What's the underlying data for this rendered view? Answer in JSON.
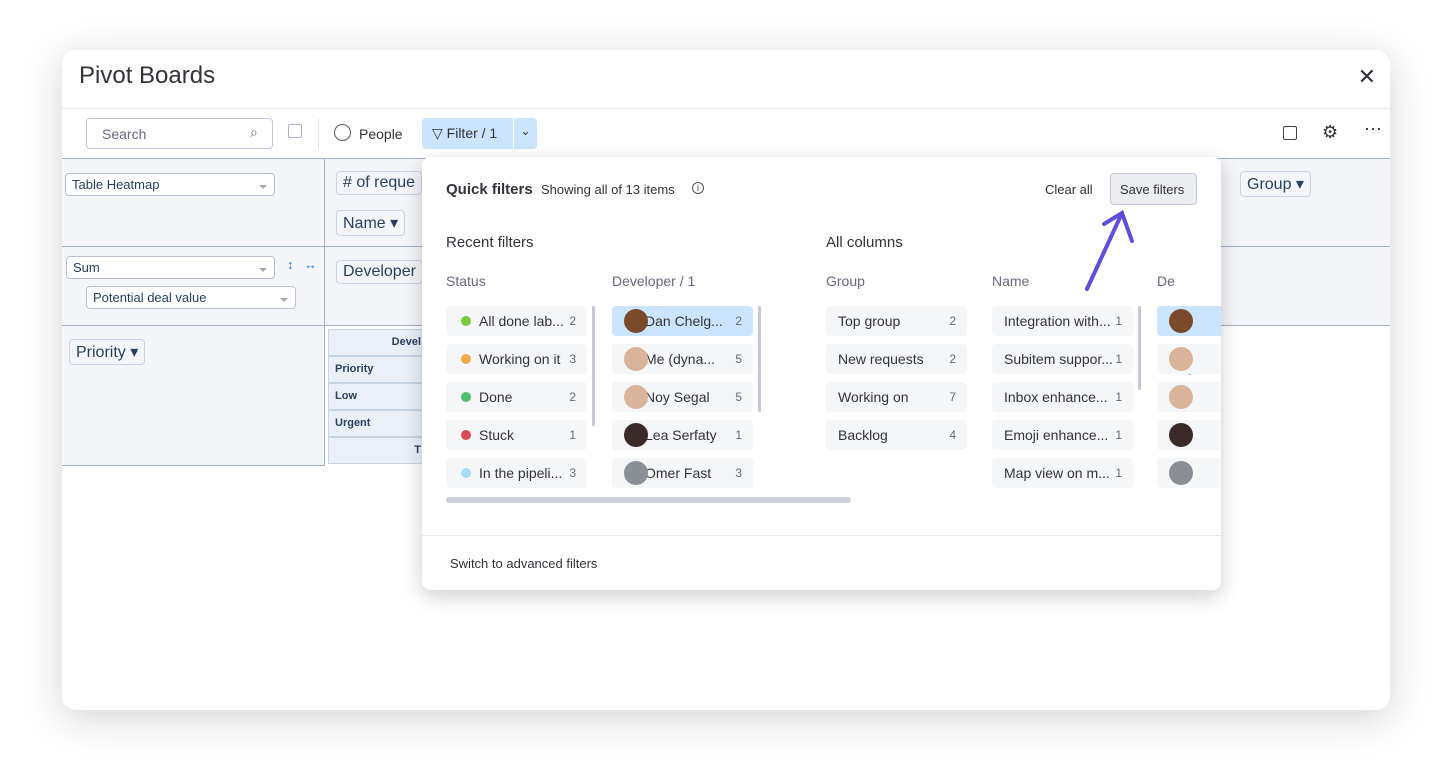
{
  "window": {
    "title": "Pivot Boards"
  },
  "toolbar": {
    "search_placeholder": "Search",
    "people": "People",
    "filter": "Filter / 1"
  },
  "pivot": {
    "renderer": "Table Heatmap",
    "aggregator": "Sum",
    "attribute": "Potential deal value",
    "col_field": "# of reque",
    "col_field2": "Name",
    "row_field_col": "Developer",
    "row_field": "Priority",
    "group_field": "Group",
    "table": {
      "header_col": "Devel",
      "header_row": "Priority",
      "rows": [
        "Low",
        "Urgent"
      ],
      "total": "T"
    }
  },
  "popup": {
    "title": "Quick filters",
    "subtitle": "Showing all of 13 items",
    "clear_all": "Clear all",
    "save": "Save filters",
    "recent": "Recent filters",
    "all_columns": "All columns",
    "advanced": "Switch to advanced filters",
    "status": {
      "header": "Status",
      "items": [
        {
          "label": "All done lab...",
          "count": "2",
          "color": "#7ec83e"
        },
        {
          "label": "Working on it",
          "count": "3",
          "color": "#f5a947"
        },
        {
          "label": "Done",
          "count": "2",
          "color": "#4fc06f"
        },
        {
          "label": "Stuck",
          "count": "1",
          "color": "#d74a5a"
        },
        {
          "label": "In the pipeli...",
          "count": "3",
          "color": "#a8dcf5"
        }
      ]
    },
    "developer": {
      "header": "Developer / 1",
      "items": [
        {
          "label": "Dan Chelg...",
          "count": "2",
          "selected": true,
          "color": "#7a4a2a"
        },
        {
          "label": "Me (dyna...",
          "count": "5",
          "color": "#d9b49a"
        },
        {
          "label": "Noy Segal",
          "count": "5",
          "color": "#d9b49a"
        },
        {
          "label": "Lea Serfaty",
          "count": "1",
          "color": "#3a2a2a"
        },
        {
          "label": "Omer Fast",
          "count": "3",
          "color": "#8a8f95"
        }
      ]
    },
    "group": {
      "header": "Group",
      "items": [
        {
          "label": "Top group",
          "count": "2"
        },
        {
          "label": "New requests",
          "count": "2"
        },
        {
          "label": "Working on",
          "count": "7"
        },
        {
          "label": "Backlog",
          "count": "4"
        }
      ]
    },
    "name": {
      "header": "Name",
      "items": [
        {
          "label": "Integration with...",
          "count": "1"
        },
        {
          "label": "Subitem suppor...",
          "count": "1"
        },
        {
          "label": "Inbox enhance...",
          "count": "1"
        },
        {
          "label": "Emoji enhance...",
          "count": "1"
        },
        {
          "label": "Map view on m...",
          "count": "1"
        }
      ]
    },
    "dev2": {
      "header": "De"
    }
  },
  "annotation": {
    "arrow_color": "#5b4fe0"
  }
}
